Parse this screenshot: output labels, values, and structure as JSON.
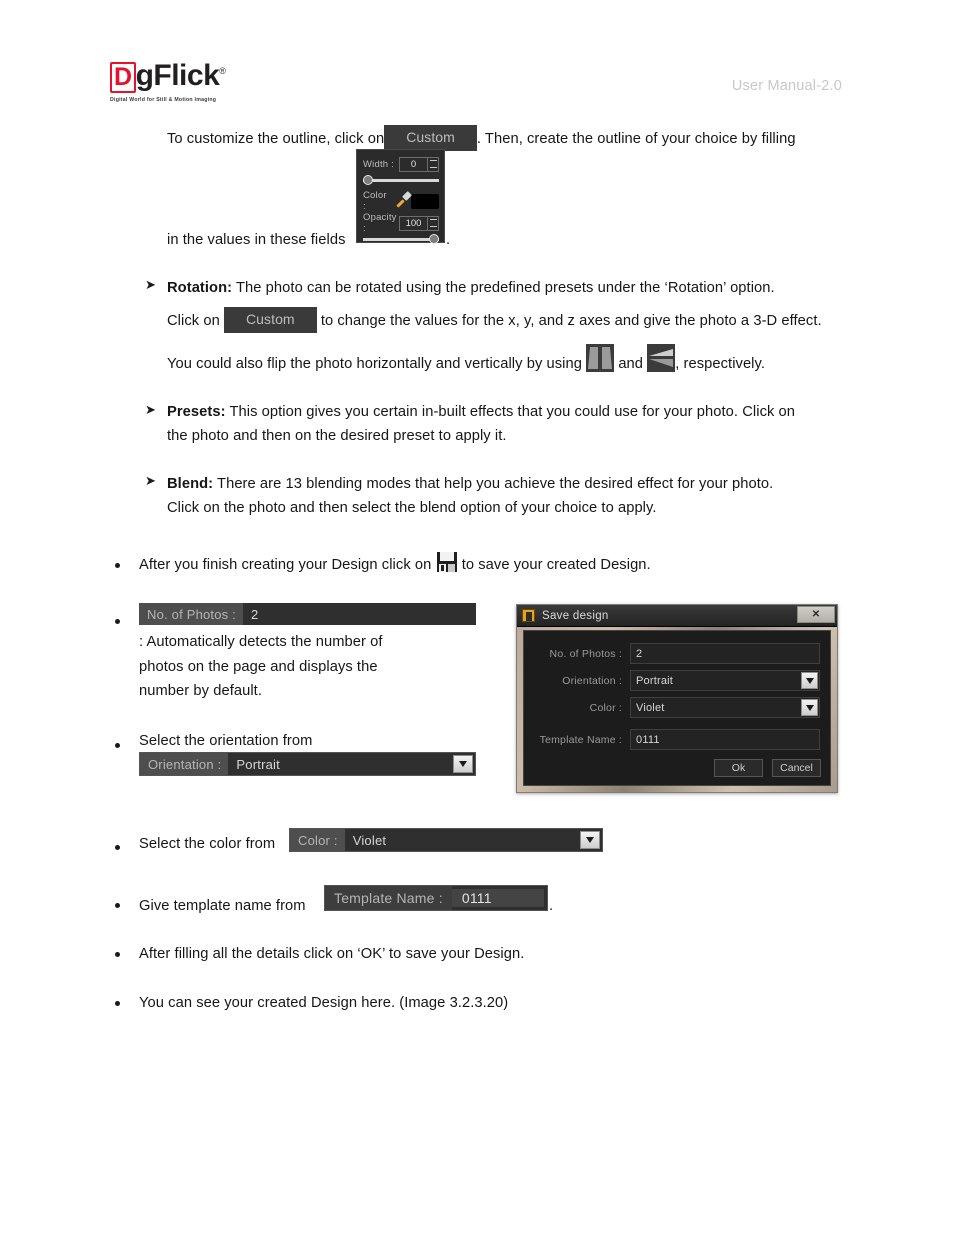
{
  "header": {
    "logo_d": "D",
    "logo_text": "gFlick",
    "logo_reg": "®",
    "logo_tagline": "Digital World for Still & Motion Imaging",
    "manual_label": "User Manual-2.0"
  },
  "content": {
    "outline_intro_pre": "To customize the outline, click on",
    "outline_btn": "Custom",
    "outline_intro_post": ". Then, create the outline of your choice by filling",
    "outline_intro_line2": "in the values in these fields",
    "outline_intro_line2_post": ".",
    "outline_widget": {
      "width_label": "Width :",
      "width_value": "0",
      "color_label": "Color :",
      "color_swatch": "#000000",
      "opacity_label": "Opacity :",
      "opacity_value": "100"
    },
    "rotation": {
      "title": "Rotation:",
      "line1": "The photo can be rotated using the predefined presets under the ‘Rotation’ option.",
      "line2_pre": "Click on",
      "btn": "Custom",
      "line2_post": "to change the values for the x, y, and z axes and give the photo a 3-D effect.",
      "line3_pre": "You could also flip the photo horizontally and vertically by using",
      "line3_mid": "and",
      "line3_post": ", respectively."
    },
    "presets": {
      "title": "Presets:",
      "line1": "This option gives you certain in-built effects that you could use for your photo. Click on",
      "line2": "the photo and then on the desired preset to apply it."
    },
    "blend": {
      "title": "Blend:",
      "line1": "There are 13 blending modes that help you achieve the desired effect for your photo.",
      "line2": "Click on the photo and then select the blend option of your choice to apply."
    },
    "save_bullet_pre": "After you finish creating your Design click on",
    "save_bullet_post": "to save your created Design.",
    "photos_field": {
      "label": "No. of Photos :",
      "value": "2"
    },
    "photos_desc_line1": ": Automatically detects the number of",
    "photos_desc_line2": "photos on the page and displays the",
    "photos_desc_line3": "number by default.",
    "orientation_bullet": "Select the orientation from",
    "orientation_field": {
      "label": "Orientation :",
      "value": "Portrait"
    },
    "color_bullet": "Select the color from",
    "color_field": {
      "label": "Color :",
      "value": "Violet"
    },
    "template_bullet": "Give template name from",
    "template_field": {
      "label": "Template Name :",
      "value": "0111"
    },
    "template_bullet_post": ".",
    "ok_bullet": "After filling all the details click on ‘OK’ to save your Design.",
    "image_ref_bullet": "You can see your created Design here. (Image 3.2.3.20)"
  },
  "dialog": {
    "title": "Save design",
    "close_label": "✕",
    "rows": [
      {
        "label": "No. of Photos :",
        "value": "2",
        "type": "input"
      },
      {
        "label": "Orientation :",
        "value": "Portrait",
        "type": "combo"
      },
      {
        "label": "Color :",
        "value": "Violet",
        "type": "combo"
      },
      {
        "label": "Template Name :",
        "value": "0111",
        "type": "input"
      }
    ],
    "ok_label": "Ok",
    "cancel_label": "Cancel"
  },
  "colors": {
    "brand_red": "#e8112d",
    "header_gray": "#c8c8c8",
    "widget_dark": "#2f2f2f",
    "widget_label": "#4e4e4e"
  }
}
